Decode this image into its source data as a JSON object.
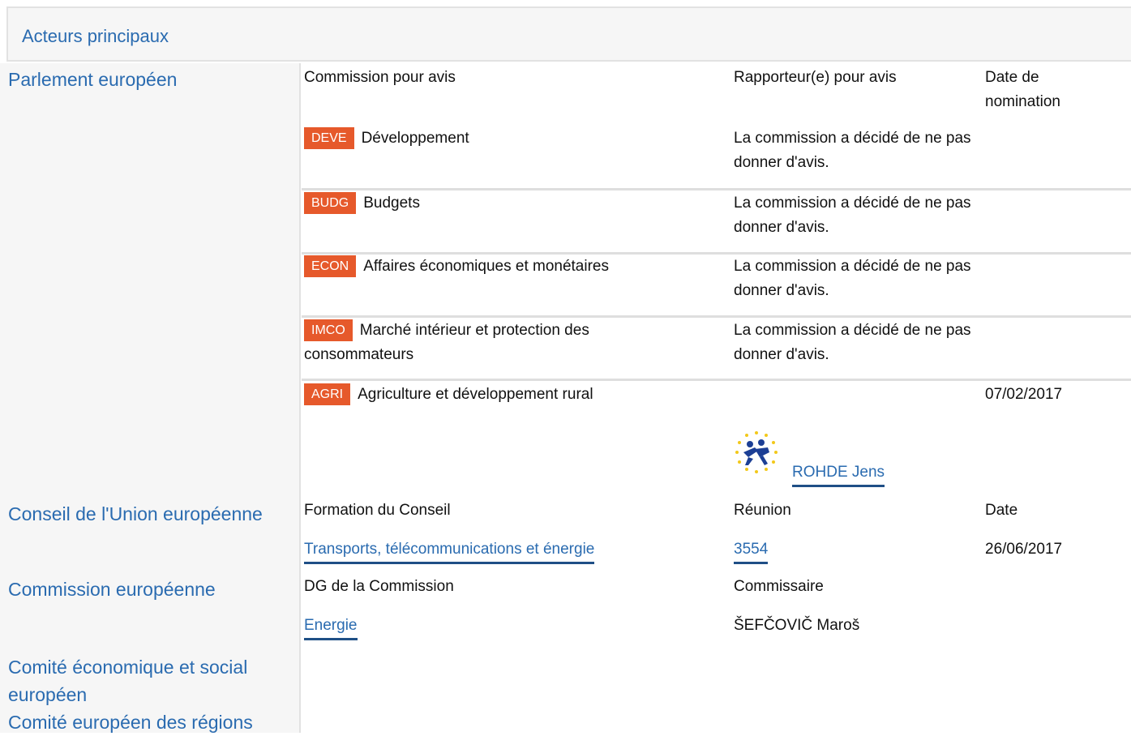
{
  "header": {
    "title": "Acteurs principaux"
  },
  "left": {
    "parlement": "Parlement européen",
    "conseil": "Conseil de l'Union européenne",
    "commission": "Commission européenne",
    "cese": "Comité économique et social européen",
    "cdr": "Comité européen des régions"
  },
  "parlement": {
    "headers": {
      "commission": "Commission pour avis",
      "rapporteur": "Rapporteur(e) pour avis",
      "date": "Date de nomination"
    },
    "rows": [
      {
        "code": "DEVE",
        "name": "Développement",
        "rapporteur": "La commission a décidé de ne pas donner d'avis.",
        "date": ""
      },
      {
        "code": "BUDG",
        "name": "Budgets",
        "rapporteur": "La commission a décidé de ne pas donner d'avis.",
        "date": ""
      },
      {
        "code": "ECON",
        "name": "Affaires économiques et monétaires",
        "rapporteur": "La commission a décidé de ne pas donner d'avis.",
        "date": ""
      },
      {
        "code": "IMCO",
        "name": "Marché intérieur et protection des consommateurs",
        "rapporteur": "La commission a décidé de ne pas donner d'avis.",
        "date": ""
      },
      {
        "code": "AGRI",
        "name": "Agriculture et développement rural",
        "rapporteur": "",
        "date": "07/02/2017"
      }
    ],
    "rapporteur_link": "ROHDE Jens"
  },
  "conseil": {
    "headers": {
      "formation": "Formation du Conseil",
      "reunion": "Réunion",
      "date": "Date"
    },
    "formation": "Transports, télécommunications et énergie",
    "reunion": "3554",
    "date": "26/06/2017"
  },
  "commission": {
    "headers": {
      "dg": "DG de la Commission",
      "commissaire": "Commissaire"
    },
    "dg": "Energie",
    "commissaire": "ŠEFČOVIČ Maroš"
  },
  "colors": {
    "accent": "#2a6bb0",
    "badge": "#e6592b",
    "panel": "#f6f6f6"
  }
}
